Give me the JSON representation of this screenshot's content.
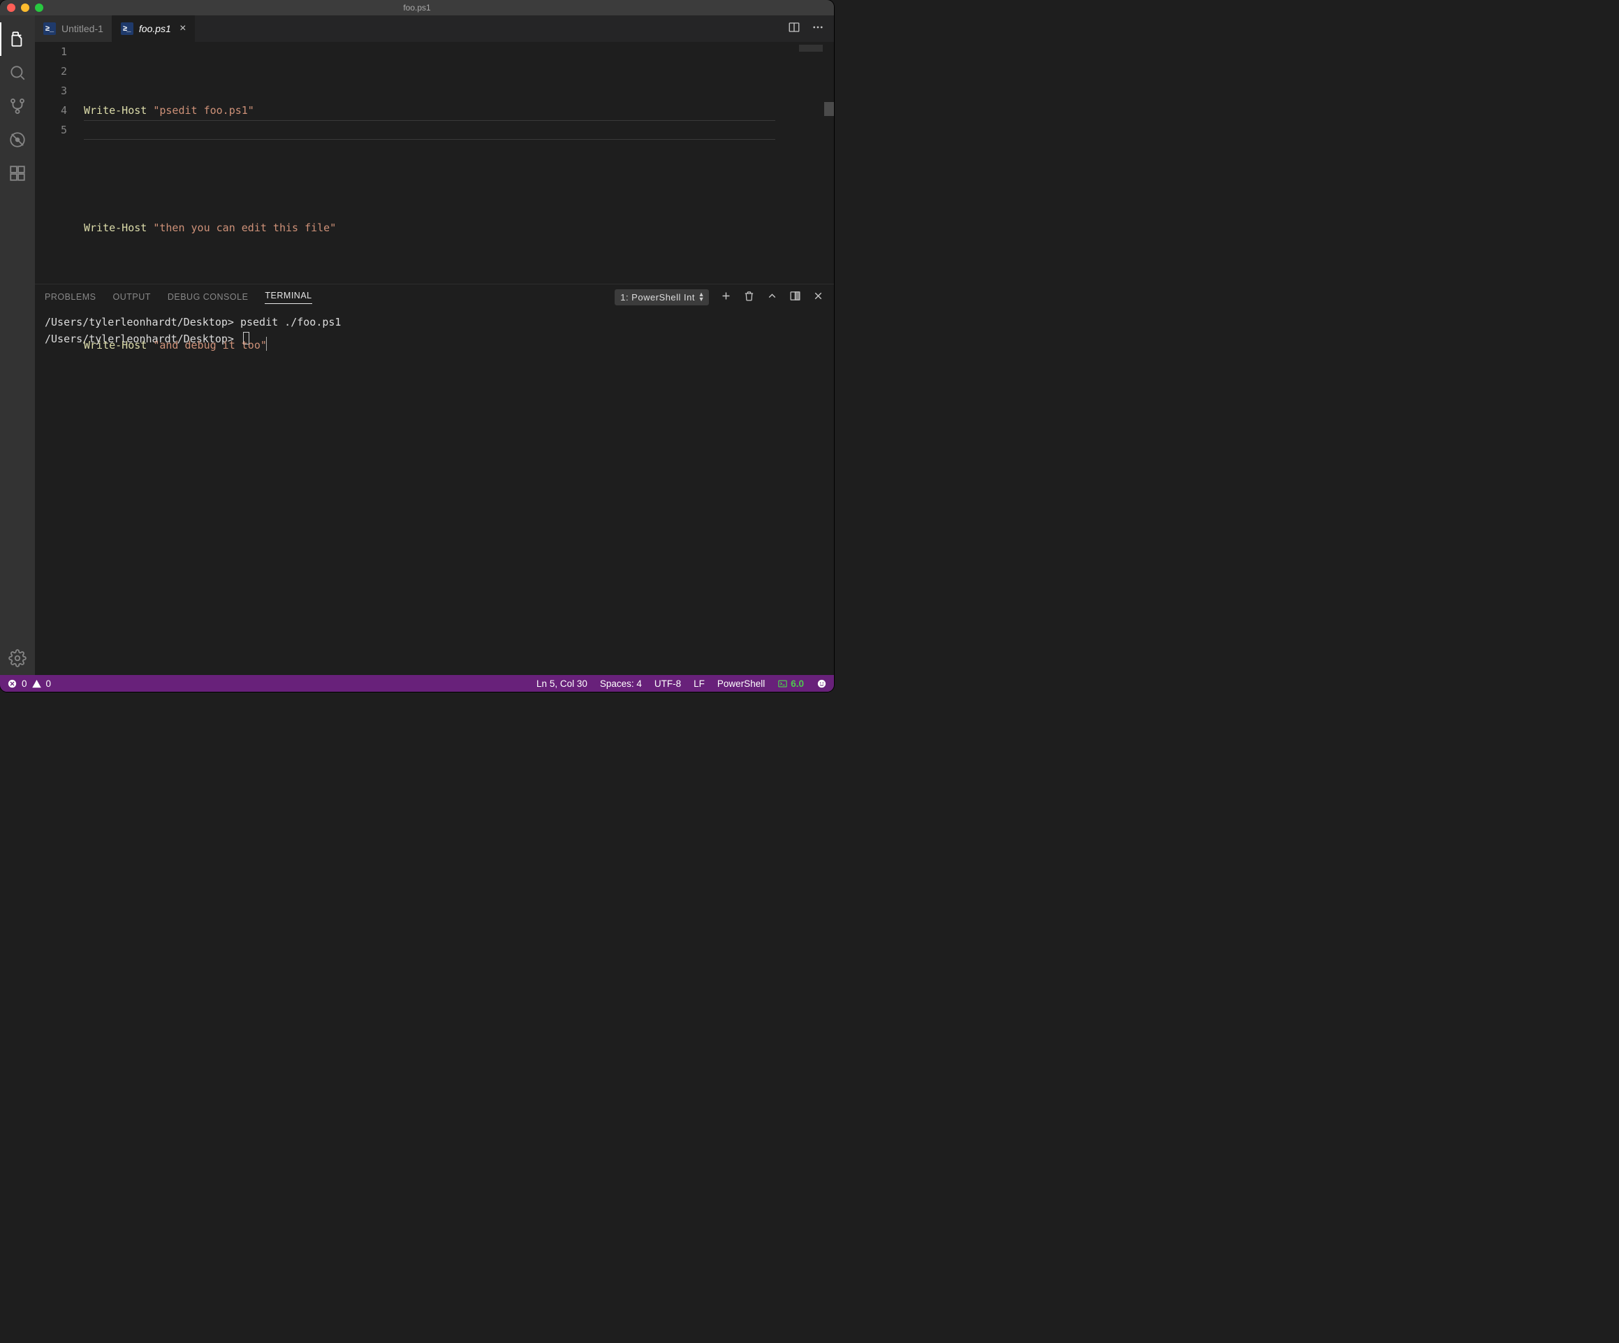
{
  "window": {
    "title": "foo.ps1"
  },
  "tabs": [
    {
      "label": "Untitled-1",
      "icon": "powershell",
      "active": false
    },
    {
      "label": "foo.ps1",
      "icon": "powershell",
      "active": true
    }
  ],
  "editor": {
    "lines": [
      {
        "n": 1,
        "cmd": "Write-Host",
        "str": "\"psedit foo.ps1\"",
        "blank": false
      },
      {
        "n": 2,
        "blank": true
      },
      {
        "n": 3,
        "cmd": "Write-Host",
        "str": "\"then you can edit this file\"",
        "blank": false
      },
      {
        "n": 4,
        "blank": true
      },
      {
        "n": 5,
        "cmd": "Write-Host",
        "str": "\"and debug it too\"",
        "blank": false,
        "current": true
      }
    ]
  },
  "panel": {
    "tabs": {
      "problems": "PROBLEMS",
      "output": "OUTPUT",
      "debug": "DEBUG CONSOLE",
      "terminal": "TERMINAL"
    },
    "activeTab": "terminal",
    "terminalSelector": "1: PowerShell Int",
    "terminalLines": [
      "/Users/tylerleonhardt/Desktop> psedit ./foo.ps1",
      "/Users/tylerleonhardt/Desktop> "
    ]
  },
  "status": {
    "errors": "0",
    "warnings": "0",
    "lncol": "Ln 5, Col 30",
    "spaces": "Spaces: 4",
    "encoding": "UTF-8",
    "eol": "LF",
    "language": "PowerShell",
    "ext": "6.0"
  }
}
